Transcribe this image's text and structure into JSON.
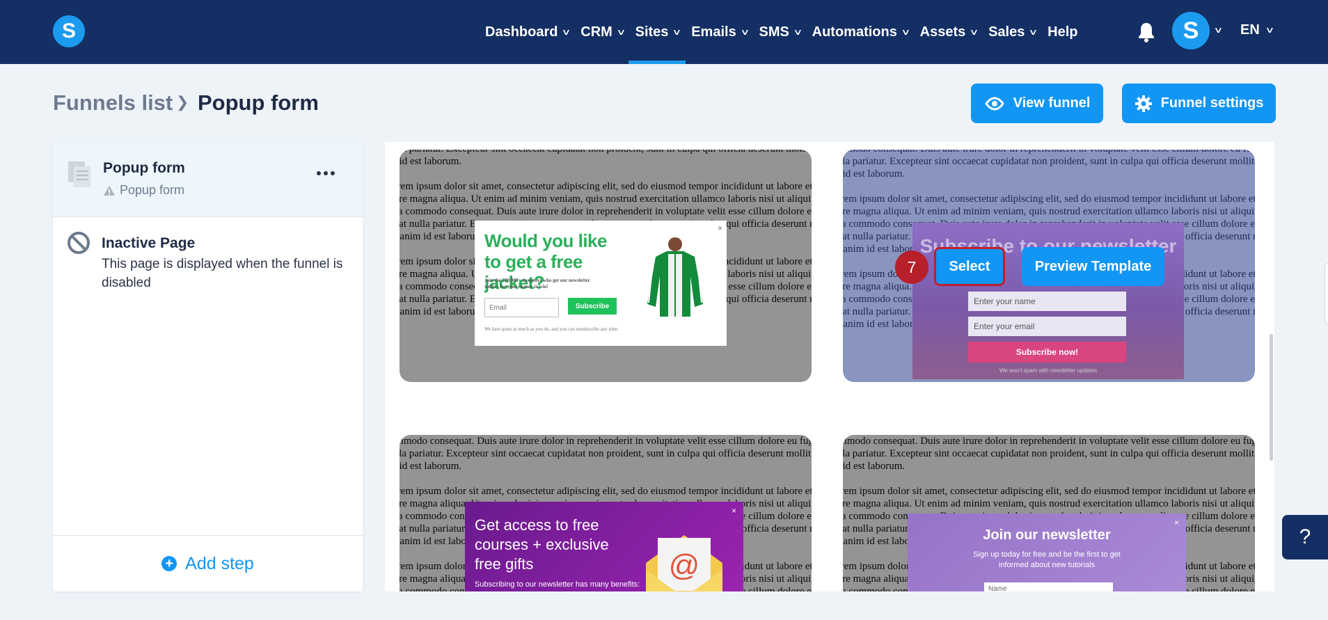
{
  "app": {
    "logo_letter": "S"
  },
  "nav": {
    "items": [
      {
        "label": "Dashboard",
        "has_menu": true
      },
      {
        "label": "CRM",
        "has_menu": true
      },
      {
        "label": "Sites",
        "has_menu": true,
        "active": true
      },
      {
        "label": "Emails",
        "has_menu": true
      },
      {
        "label": "SMS",
        "has_menu": true
      },
      {
        "label": "Automations",
        "has_menu": true
      },
      {
        "label": "Assets",
        "has_menu": true
      },
      {
        "label": "Sales",
        "has_menu": true
      },
      {
        "label": "Help",
        "has_menu": false
      }
    ],
    "avatar_letter": "S",
    "language": "EN"
  },
  "breadcrumb": {
    "parent": "Funnels list",
    "current": "Popup form"
  },
  "actions": {
    "view_funnel": "View funnel",
    "funnel_settings": "Funnel settings"
  },
  "steps": {
    "active_step": {
      "title": "Popup form",
      "subtitle": "Popup form"
    },
    "inactive_page": {
      "title": "Inactive Page",
      "description": "This page is displayed when the funnel is disabled"
    },
    "add_step": "Add step"
  },
  "templates": {
    "lorem_a": "nulla pariatur. Excepteur sint occaecat cupidatat non proident, sunt in culpa qui officia deserunt mollit anim id est laborum.",
    "lorem_b": "Lorem ipsum dolor sit amet, consectetur adipiscing elit, sed do eiusmod tempor incididunt ut labore et dolore magna aliqua. Ut enim ad minim veniam, quis nostrud exercitation ullamco laboris nisi ut aliquip ex ea commodo consequat. Duis aute irure dolor in reprehenderit in voluptate velit esse cillum dolore eu fugiat nulla pariatur. Excepteur sint occaecat cupidatat non proident, sunt in culpa qui officia deserunt mollit anim id est laborum.",
    "lorem_c": "commodo consequat. Duis aute irure dolor in reprehenderit in voluptate velit esse cillum dolore eu fugiat nulla pariatur. Excepteur sint occaecat cupidatat non proident, sunt in culpa qui officia deserunt mollit anim id est laborum.",
    "card1": {
      "title": "Would you like to get a free jacket?",
      "small": "Join the 200,000+ designers who get our newsletter weekly for your chance to win!",
      "email_placeholder": "Email",
      "subscribe": "Subscribe",
      "footer": "We hate spam as much as you do, and you can unsubscribe any time.",
      "close": "×"
    },
    "card2": {
      "title": "Subscribe to our newsletter",
      "name_placeholder": "Enter your name",
      "email_placeholder": "Enter your email",
      "button": "Subscribe now!",
      "footer": "We won't spam with newsletter updates",
      "step_badge": "7",
      "select": "Select",
      "preview": "Preview Template"
    },
    "card3": {
      "title": "Get access to free courses + exclusive free gifts",
      "small": "Subscribing to our newsletter has many benefits:",
      "close": "×"
    },
    "card4": {
      "title": "Join our newsletter",
      "subtitle": "Sign up today for free and be the first to get informed about new tutorials",
      "name_placeholder": "Name",
      "close": "×"
    }
  },
  "help": {
    "label": "?"
  },
  "colors": {
    "topbar": "#142f63",
    "accent": "#1196f5",
    "badge": "#b71f2a"
  }
}
